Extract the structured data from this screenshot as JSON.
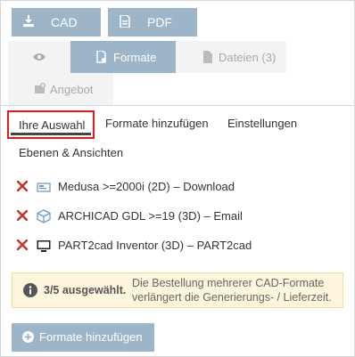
{
  "top_buttons": {
    "cad_label": "CAD",
    "pdf_label": "PDF"
  },
  "tabs": {
    "view_icon": "eye-icon",
    "formate": "Formate",
    "dateien": "Dateien (3)",
    "angebot": "Angebot"
  },
  "subtabs": {
    "selected": "Ihre Auswahl",
    "add": "Formate hinzufügen",
    "settings": "Einstellungen",
    "layers": "Ebenen & Ansichten"
  },
  "items": [
    {
      "text": "Medusa >=2000i (2D) – Download",
      "icon": "drawing-icon"
    },
    {
      "text": "ARCHICAD GDL >=19 (3D) – Email",
      "icon": "cube-icon"
    },
    {
      "text": "PART2cad Inventor (3D) – PART2cad",
      "icon": "monitor-icon"
    }
  ],
  "notice": {
    "count": "3/5 ausgewählt.",
    "message": "Die Bestellung mehrerer CAD-Formate verlängert die Generierungs- / Lieferzeit."
  },
  "add_button": {
    "label": "Formate hinzufügen"
  },
  "colors": {
    "accent": "#9db5c9",
    "remove": "#c0392b",
    "highlight": "#e3191b",
    "notice_bg": "#fdf6dc"
  }
}
